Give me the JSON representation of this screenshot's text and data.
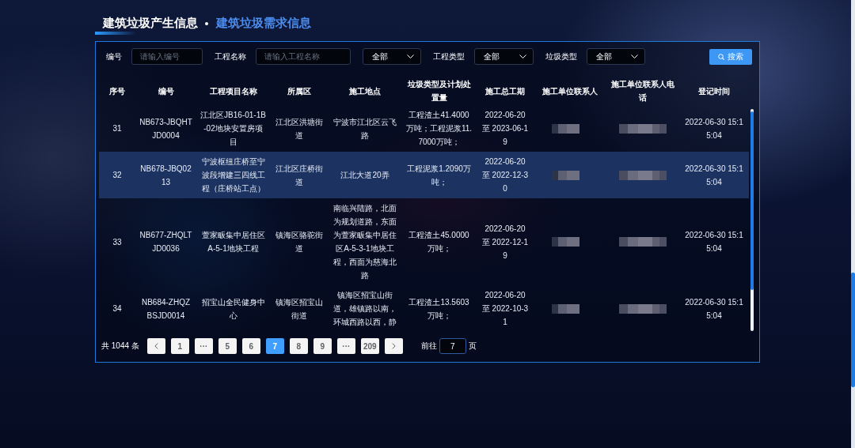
{
  "tabs": [
    {
      "label": "建筑垃圾产生信息",
      "selected": true
    },
    {
      "label": "建筑垃圾需求信息",
      "selected": false
    }
  ],
  "filters": [
    {
      "kind": "input",
      "label": "编号",
      "placeholder": "请输入编号"
    },
    {
      "kind": "input",
      "label": "工程名称",
      "placeholder": "请输入工程名称"
    },
    {
      "kind": "select",
      "value": "全部"
    },
    {
      "kind": "select",
      "label": "工程类型",
      "value": "全部"
    },
    {
      "kind": "select",
      "label": "垃圾类型",
      "value": "全部"
    }
  ],
  "search_button": {
    "label": "搜索"
  },
  "table": {
    "columns": [
      "序号",
      "编号",
      "工程项目名称",
      "所属区",
      "施工地点",
      "垃圾类型及计划处置量",
      "施工总工期",
      "施工单位联系人",
      "施工单位联系人电话",
      "登记时间"
    ],
    "rows": [
      {
        "selected": false,
        "cells": [
          "31",
          "NB673-JBQHTJD0004",
          "江北区JB16-01-1B-02地块安置房项目",
          "江北区洪塘街道",
          "宁波市江北区云飞路",
          "工程渣土41.4000万吨；工程泥浆11.7000万吨；",
          "2022-06-20 至 2023-06-19",
          {
            "kind": "blurred"
          },
          {
            "kind": "blurred"
          },
          "2022-06-30 15:15:04"
        ]
      },
      {
        "selected": true,
        "cells": [
          "32",
          "NB678-JBQ0213",
          "宁波枢纽庄桥至宁波段增建三四线工程（庄桥站工点）",
          "江北区庄桥街道",
          "江北大道20弄",
          "工程泥浆1.2090万吨；",
          "2022-06-20 至 2022-12-30",
          {
            "kind": "blurred"
          },
          {
            "kind": "blurred"
          },
          "2022-06-30 15:15:04"
        ]
      },
      {
        "selected": false,
        "cells": [
          "33",
          "NB677-ZHQLTJD0036",
          "萱家畈集中居住区A-5-1地块工程",
          "镇海区骆驼街道",
          "南临兴陆路，北面为规划道路，东面为萱家畈集中居住区A-5-3-1地块工程，西面为慈海北路",
          "工程渣土45.0000万吨；",
          "2022-06-20 至 2022-12-19",
          {
            "kind": "blurred"
          },
          {
            "kind": "blurred"
          },
          "2022-06-30 15:15:04"
        ]
      },
      {
        "selected": false,
        "cells": [
          "34",
          "NB684-ZHQZBSJD0014",
          "招宝山全民健身中心",
          "镇海区招宝山街道",
          "镇海区招宝山街道，雄镇路以南，环城西路以西，静",
          "工程渣土13.5603万吨；",
          "2022-06-20 至 2022-10-31",
          {
            "kind": "blurred"
          },
          {
            "kind": "blurred"
          },
          "2022-06-30 15:15:04"
        ]
      }
    ]
  },
  "pagination": {
    "total": "共 1044 条",
    "pages": [
      {
        "label": "1",
        "selected": false
      },
      {
        "label": "···",
        "selected": false
      },
      {
        "label": "5",
        "selected": false
      },
      {
        "label": "6",
        "selected": false
      },
      {
        "label": "7",
        "selected": true
      },
      {
        "label": "8",
        "selected": false
      },
      {
        "label": "9",
        "selected": false
      },
      {
        "label": "···",
        "selected": false
      },
      {
        "label": "209",
        "selected": false
      }
    ],
    "jump_label": "前往",
    "jump_value": "7",
    "jump_suffix": "页"
  }
}
